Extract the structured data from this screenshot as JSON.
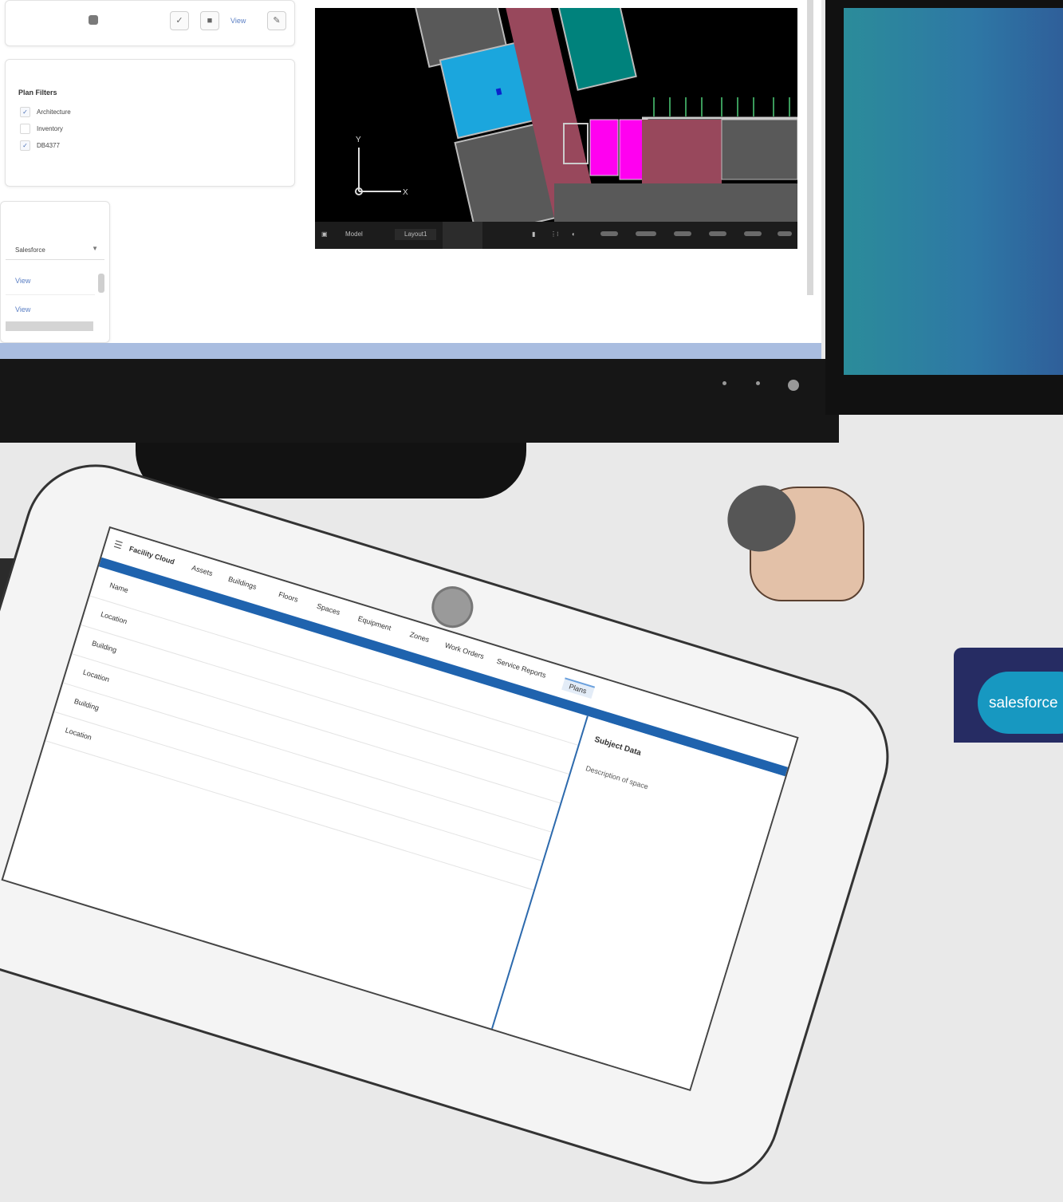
{
  "left_monitor": {
    "toolbar": {
      "layers_icon": "layers-icon",
      "check_label": "✓",
      "square_label": "■",
      "view_label": "View",
      "edit_icon": "pencil-icon"
    },
    "filter_panel": {
      "title": "Plan Filters",
      "items": [
        {
          "label": "Architecture",
          "checked": true
        },
        {
          "label": "Inventory",
          "checked": false
        },
        {
          "label": "DB4377",
          "checked": true
        }
      ]
    },
    "list_panel": {
      "select_value": "Salesforce",
      "rows": [
        {
          "link": "View"
        },
        {
          "link": "View"
        }
      ]
    },
    "viewer": {
      "axis_y": "Y",
      "axis_x": "X",
      "tabs": [
        "Model",
        "Layout1"
      ],
      "colors": {
        "blue_room": "#1ba6dd",
        "crimson": "#98485c",
        "teal": "#00827c",
        "magenta": "#ff00f0",
        "grey_room": "#595959"
      }
    }
  },
  "tablet": {
    "header": {
      "title": "Facility Cloud",
      "crumbs": [
        "Assets",
        "Buildings",
        "Floors",
        "Spaces",
        "Equipment",
        "Zones",
        "Work Orders",
        "Service Reports"
      ],
      "active_tab": "Plans"
    },
    "side_panel": {
      "title": "Subject Data",
      "sub": "Description of space"
    },
    "rows": [
      "Name",
      "Location",
      "Building",
      "Location",
      "Building",
      "Location"
    ]
  },
  "brand": {
    "name": "salesforce",
    "colors": {
      "badge_bg": "#262c63",
      "cloud": "#1798c1"
    }
  }
}
